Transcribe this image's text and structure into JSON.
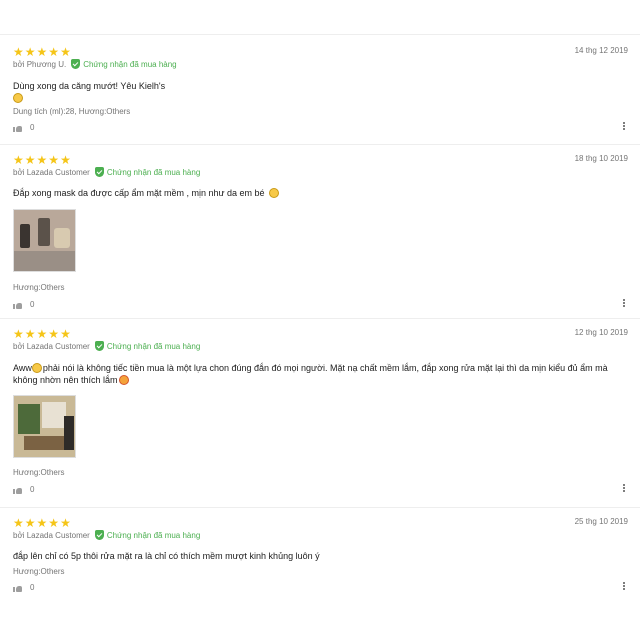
{
  "reviews": [
    {
      "stars": 5,
      "date": "14 thg 12 2019",
      "author": "bởi Phương U.",
      "verified_label": "Chứng nhận đã mua hàng",
      "content": "Dùng xong da căng mướt! Yêu Kielh's",
      "meta": "Dung tích (ml):28, Hương:Others",
      "likes": "0",
      "has_photo": false
    },
    {
      "stars": 5,
      "date": "18 thg 10 2019",
      "author": "bởi Lazada Customer",
      "verified_label": "Chứng nhận đã mua hàng",
      "content": "Đắp xong mask da được cấp ẩm mặt mềm , mịn như da em bé",
      "meta": "Hương:Others",
      "likes": "0",
      "has_photo": true
    },
    {
      "stars": 5,
      "date": "12 thg 10 2019",
      "author": "bởi Lazada Customer",
      "verified_label": "Chứng nhận đã mua hàng",
      "content_a": "Aww",
      "content_b": "phải nói là không tiếc tiền mua là một lựa chon đúng đắn đó mọi người. Mặt nạ chất mềm lắm, đắp xong rửa mặt lại thì da mịn kiểu đủ ẩm mà không nhờn nên thích lắm",
      "meta": "Hương:Others",
      "likes": "0",
      "has_photo": true
    },
    {
      "stars": 5,
      "date": "25 thg 10 2019",
      "author": "bởi Lazada Customer",
      "verified_label": "Chứng nhận đã mua hàng",
      "content": "đắp lên chỉ có 5p thôi rửa mặt ra là chỉ có thích mềm mượt kinh khủng luôn ý",
      "meta": "Hương:Others",
      "likes": "0",
      "has_photo": false
    }
  ],
  "icons": {
    "star": "star-icon",
    "verified": "shield-check-icon",
    "like": "thumbs-up-icon",
    "more": "more-vertical-icon"
  },
  "colors": {
    "star": "#f5c518",
    "verified": "#4caf50",
    "muted_text": "#757575",
    "divider": "#eeeeee"
  }
}
